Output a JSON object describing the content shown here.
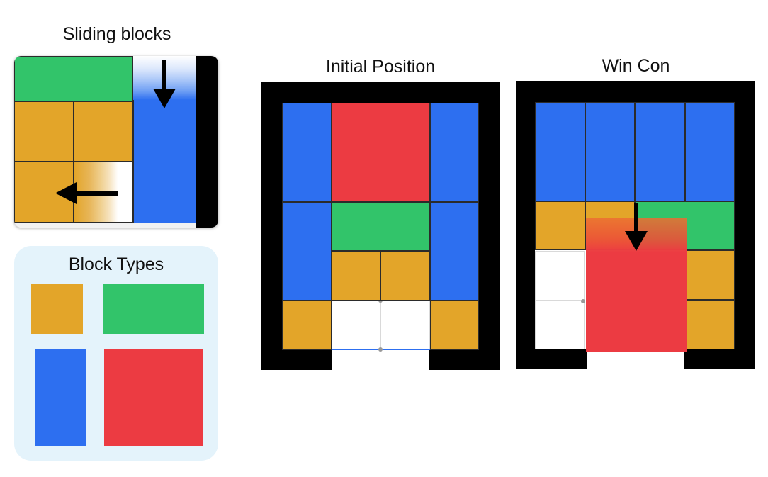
{
  "colors": {
    "orange": "#e3a529",
    "green": "#32c46a",
    "blue": "#2d6ff0",
    "red": "#ec3b42",
    "wall": "#000000",
    "panel_bg": "#e4f3fb",
    "empty": "#ffffff"
  },
  "sliding": {
    "title": "Sliding blocks",
    "arrows": [
      "arrow-down-icon",
      "arrow-left-icon"
    ]
  },
  "types": {
    "title": "Block Types",
    "items": [
      {
        "name": "small-square-1x1",
        "color": "orange"
      },
      {
        "name": "horizontal-1x2",
        "color": "green"
      },
      {
        "name": "vertical-2x1",
        "color": "blue"
      },
      {
        "name": "big-square-2x2",
        "color": "red"
      }
    ]
  },
  "initial": {
    "title": "Initial Position",
    "grid": {
      "cols": 4,
      "rows": 5
    },
    "blocks": [
      {
        "name": "blue-left-top",
        "color": "blue",
        "c": 0,
        "r": 0,
        "w": 1,
        "h": 2
      },
      {
        "name": "red-big",
        "color": "red",
        "c": 1,
        "r": 0,
        "w": 2,
        "h": 2
      },
      {
        "name": "blue-right-top",
        "color": "blue",
        "c": 3,
        "r": 0,
        "w": 1,
        "h": 2
      },
      {
        "name": "blue-left-bottom",
        "color": "blue",
        "c": 0,
        "r": 2,
        "w": 1,
        "h": 2
      },
      {
        "name": "green-horizontal",
        "color": "green",
        "c": 1,
        "r": 2,
        "w": 2,
        "h": 1
      },
      {
        "name": "blue-right-bottom",
        "color": "blue",
        "c": 3,
        "r": 2,
        "w": 1,
        "h": 2
      },
      {
        "name": "orange-a",
        "color": "orange",
        "c": 1,
        "r": 3,
        "w": 1,
        "h": 1
      },
      {
        "name": "orange-b",
        "color": "orange",
        "c": 2,
        "r": 3,
        "w": 1,
        "h": 1
      },
      {
        "name": "orange-c",
        "color": "orange",
        "c": 0,
        "r": 4,
        "w": 1,
        "h": 1
      },
      {
        "name": "orange-d",
        "color": "orange",
        "c": 3,
        "r": 4,
        "w": 1,
        "h": 1
      }
    ]
  },
  "win": {
    "title": "Win Con",
    "grid": {
      "cols": 4,
      "rows": 5
    },
    "blocks": [
      {
        "name": "blue-1",
        "color": "blue",
        "c": 0,
        "r": 0,
        "w": 1,
        "h": 2
      },
      {
        "name": "blue-2",
        "color": "blue",
        "c": 1,
        "r": 0,
        "w": 1,
        "h": 2
      },
      {
        "name": "blue-3",
        "color": "blue",
        "c": 2,
        "r": 0,
        "w": 1,
        "h": 2
      },
      {
        "name": "blue-4",
        "color": "blue",
        "c": 3,
        "r": 0,
        "w": 1,
        "h": 2
      },
      {
        "name": "orange-a",
        "color": "orange",
        "c": 0,
        "r": 2,
        "w": 1,
        "h": 1
      },
      {
        "name": "orange-b",
        "color": "orange",
        "c": 1,
        "r": 2,
        "w": 1,
        "h": 1
      },
      {
        "name": "green-horizontal",
        "color": "green",
        "c": 2,
        "r": 2,
        "w": 2,
        "h": 1
      },
      {
        "name": "orange-c",
        "color": "orange",
        "c": 3,
        "r": 3,
        "w": 1,
        "h": 1
      },
      {
        "name": "orange-d",
        "color": "orange",
        "c": 3,
        "r": 4,
        "w": 1,
        "h": 1
      }
    ]
  }
}
